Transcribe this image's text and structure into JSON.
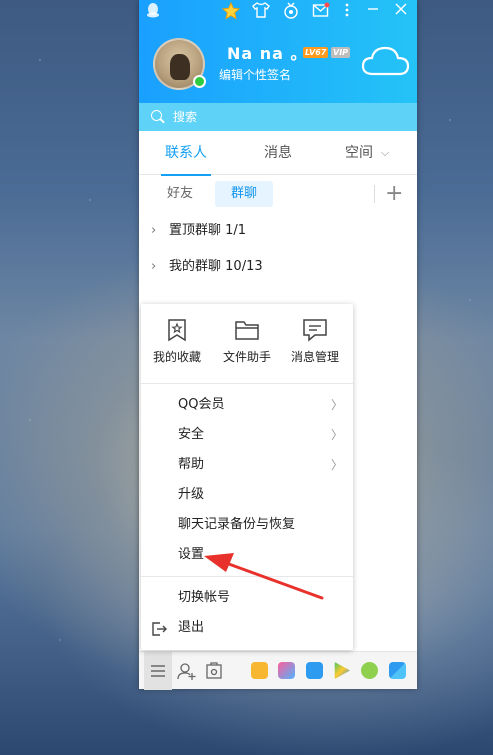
{
  "window": {
    "profile": {
      "nickname": "Na  na 。",
      "level_badge": "LV67",
      "vip_badge": "VIP",
      "signature": "编辑个性签名",
      "status": "online"
    },
    "topbar_icons": [
      "qq-penguin-icon",
      "star-icon",
      "shirt-icon",
      "medal-icon",
      "mail-icon",
      "more-icon",
      "minimize-icon",
      "close-icon"
    ],
    "search": {
      "placeholder": "搜索"
    },
    "tabs": [
      {
        "label": "联系人",
        "active": true
      },
      {
        "label": "消息",
        "active": false
      },
      {
        "label": "空间",
        "active": false
      }
    ],
    "subtabs": [
      {
        "label": "好友",
        "active": false
      },
      {
        "label": "群聊",
        "active": true
      }
    ],
    "groups": [
      {
        "name": "置顶群聊",
        "count": "1/1"
      },
      {
        "name": "我的群聊",
        "count": "10/13"
      }
    ]
  },
  "menu": {
    "quick_actions": [
      {
        "label": "我的收藏",
        "icon": "bookmark-star-icon"
      },
      {
        "label": "文件助手",
        "icon": "folder-icon"
      },
      {
        "label": "消息管理",
        "icon": "message-manage-icon"
      }
    ],
    "items": [
      {
        "label": "QQ会员",
        "has_submenu": true
      },
      {
        "label": "安全",
        "has_submenu": true
      },
      {
        "label": "帮助",
        "has_submenu": true
      },
      {
        "label": "升级",
        "has_submenu": false
      },
      {
        "label": "聊天记录备份与恢复",
        "has_submenu": false
      },
      {
        "label": "设置",
        "has_submenu": false
      }
    ],
    "bottom_items": [
      {
        "label": "切换帐号"
      },
      {
        "label": "退出",
        "icon": "logout-icon"
      }
    ]
  },
  "colors": {
    "accent": "#12a0f5",
    "header_start": "#1aa0ff",
    "header_end": "#24c3f7",
    "annotation_arrow": "#e8312a"
  }
}
